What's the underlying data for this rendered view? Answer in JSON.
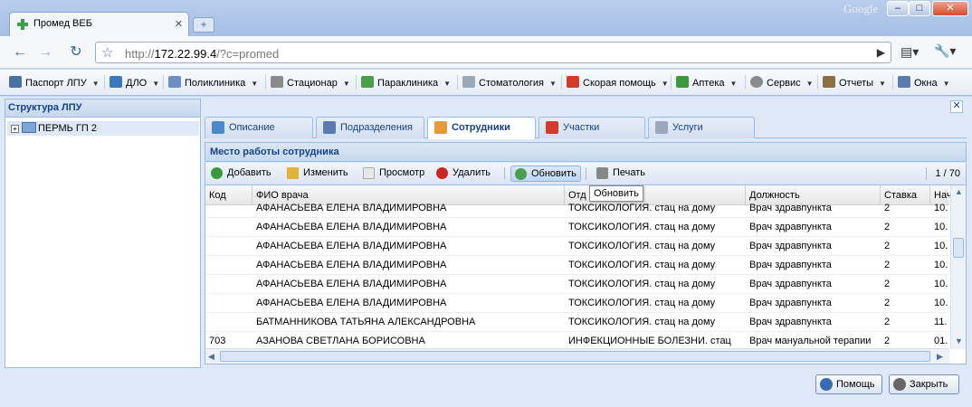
{
  "browser": {
    "tab_title": "Промед ВЕБ",
    "brand": "Google",
    "url_host": "http://",
    "url_main": "172.22.99.4",
    "url_rest": "/?c=promed"
  },
  "menu": {
    "items": [
      {
        "label": "Паспорт ЛПУ",
        "color": "#4a6fa5"
      },
      {
        "label": "ДЛО",
        "color": "#3a78c0"
      },
      {
        "label": "Поликлиника",
        "color": "#6b8ec5"
      },
      {
        "label": "Стационар",
        "color": "#8a8a8a"
      },
      {
        "label": "Параклиника",
        "color": "#4aa04a"
      },
      {
        "label": "Стоматология",
        "color": "#9aa8bc"
      },
      {
        "label": "Скорая помощь",
        "color": "#d23a2a"
      },
      {
        "label": "Аптека",
        "color": "#3a9a3a"
      },
      {
        "label": "Сервис",
        "color": "#8a8a8a"
      },
      {
        "label": "Отчеты",
        "color": "#8a7040"
      },
      {
        "label": "Окна",
        "color": "#5a7ab0"
      }
    ]
  },
  "left": {
    "title": "Структура ЛПУ",
    "tree_item": "ПЕРМЬ ГП 2"
  },
  "tabs": [
    {
      "label": "Описание",
      "color": "#4a8acb",
      "active": false
    },
    {
      "label": "Подразделения",
      "color": "#5a7ab0",
      "active": false
    },
    {
      "label": "Сотрудники",
      "color": "#e39a3a",
      "active": true
    },
    {
      "label": "Участки",
      "color": "#d23a2a",
      "active": false
    },
    {
      "label": "Услуги",
      "color": "#9aa8bc",
      "active": false
    }
  ],
  "panel_title": "Место работы сотрудника",
  "toolbar": {
    "add": "Добавить",
    "edit": "Изменить",
    "view": "Просмотр",
    "delete": "Удалить",
    "refresh": "Обновить",
    "print": "Печать",
    "page": "1 / 70",
    "tooltip": "Обновить"
  },
  "grid": {
    "columns": [
      "Код",
      "ФИО врача",
      "Отд",
      "Должность",
      "Ставка",
      "Начало"
    ],
    "rows": [
      [
        "",
        "АФАНАСЬЕВА ЕЛЕНА ВЛАДИМИРОВНА",
        "ТОКСИКОЛОГИЯ. стац на дому",
        "Врач здравпункта",
        "2",
        "10."
      ],
      [
        "",
        "АФАНАСЬЕВА ЕЛЕНА ВЛАДИМИРОВНА",
        "ТОКСИКОЛОГИЯ. стац на дому",
        "Врач здравпункта",
        "2",
        "10."
      ],
      [
        "",
        "АФАНАСЬЕВА ЕЛЕНА ВЛАДИМИРОВНА",
        "ТОКСИКОЛОГИЯ. стац на дому",
        "Врач здравпункта",
        "2",
        "10."
      ],
      [
        "",
        "АФАНАСЬЕВА ЕЛЕНА ВЛАДИМИРОВНА",
        "ТОКСИКОЛОГИЯ. стац на дому",
        "Врач здравпункта",
        "2",
        "10."
      ],
      [
        "",
        "АФАНАСЬЕВА ЕЛЕНА ВЛАДИМИРОВНА",
        "ТОКСИКОЛОГИЯ. стац на дому",
        "Врач здравпункта",
        "2",
        "10."
      ],
      [
        "",
        "АФАНАСЬЕВА ЕЛЕНА ВЛАДИМИРОВНА",
        "ТОКСИКОЛОГИЯ. стац на дому",
        "Врач здравпункта",
        "2",
        "10."
      ],
      [
        "",
        "БАТМАННИКОВА ТАТЬЯНА АЛЕКСАНДРОВНА",
        "ТОКСИКОЛОГИЯ. стац на дому",
        "Врач здравпункта",
        "2",
        "11."
      ],
      [
        "703",
        "АЗАНОВА СВЕТЛАНА БОРИСОВНА",
        "ИНФЕКЦИОННЫЕ БОЛЕЗНИ. стац",
        "Врач мануальной терапии",
        "2",
        "01."
      ]
    ]
  },
  "bottom": {
    "help": "Помощь",
    "close": "Закрыть"
  }
}
